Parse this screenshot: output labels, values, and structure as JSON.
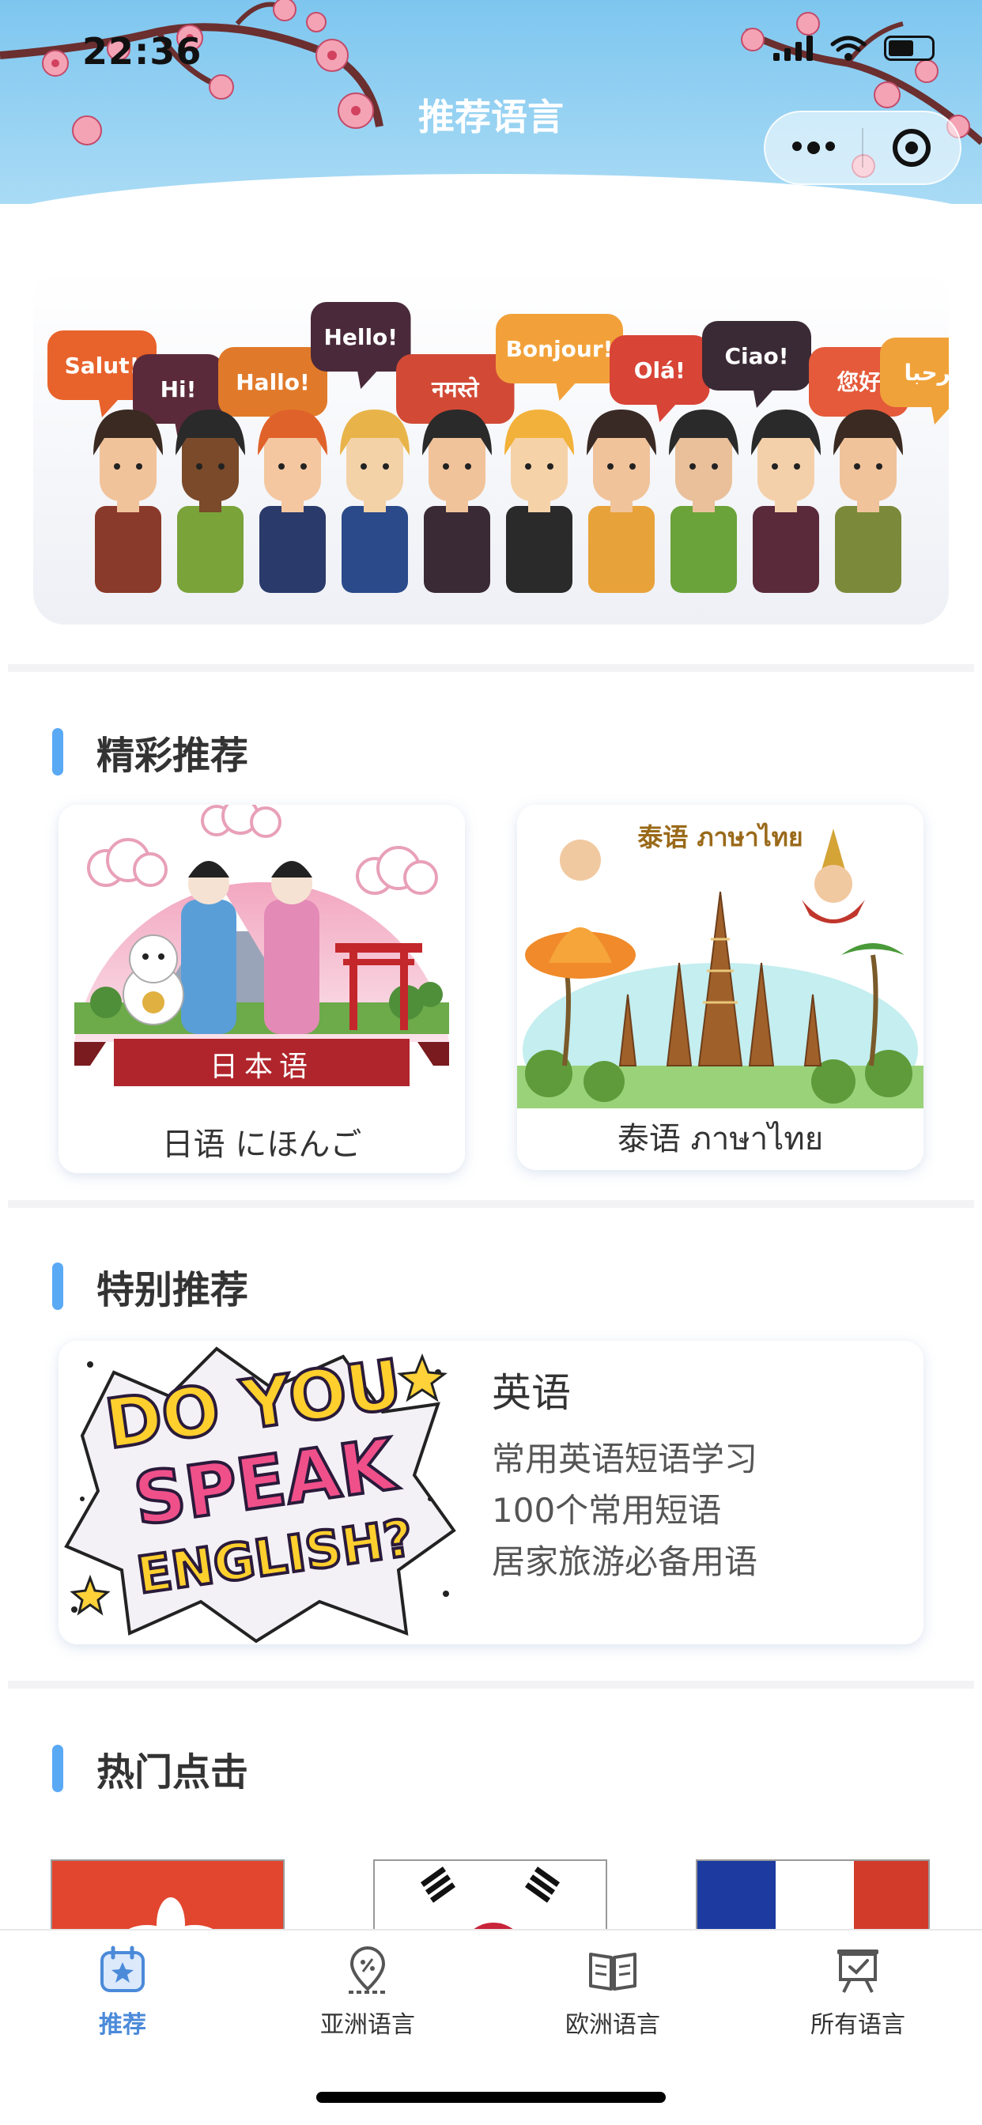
{
  "status_bar": {
    "time": "22:36"
  },
  "header": {
    "title": "推荐语言"
  },
  "banner": {
    "greetings": [
      "Salut!",
      "Hi!",
      "Hallo!",
      "Hello!",
      "नमस्ते",
      "Bonjour!",
      "Olá!",
      "Ciao!",
      "您好",
      "مرحبا"
    ]
  },
  "sections": {
    "featured": {
      "title": "精彩推荐",
      "cards": [
        {
          "caption": "日语 にほんご",
          "ribbon": "日本语"
        },
        {
          "caption": "泰语 ภาษาไทย",
          "art_title": "泰语 ภาษาไทย"
        }
      ]
    },
    "special": {
      "title": "特别推荐",
      "card": {
        "art_text": [
          "DO YOU",
          "SPEAK",
          "ENGLISH?"
        ],
        "title": "英语",
        "lines": [
          "常用英语短语学习",
          "100个常用短语",
          "居家旅游必备用语"
        ]
      }
    },
    "hot": {
      "title": "热门点击"
    }
  },
  "tabbar": {
    "tabs": [
      {
        "label": "推荐",
        "icon": "calendar-star-icon",
        "active": true
      },
      {
        "label": "亚洲语言",
        "icon": "map-pin-icon",
        "active": false
      },
      {
        "label": "欧洲语言",
        "icon": "open-book-icon",
        "active": false
      },
      {
        "label": "所有语言",
        "icon": "easel-check-icon",
        "active": false
      }
    ],
    "active_color": "#4b8ad9"
  },
  "colors": {
    "accent": "#5aa9f5",
    "header_sky": "#7ec6ef"
  }
}
